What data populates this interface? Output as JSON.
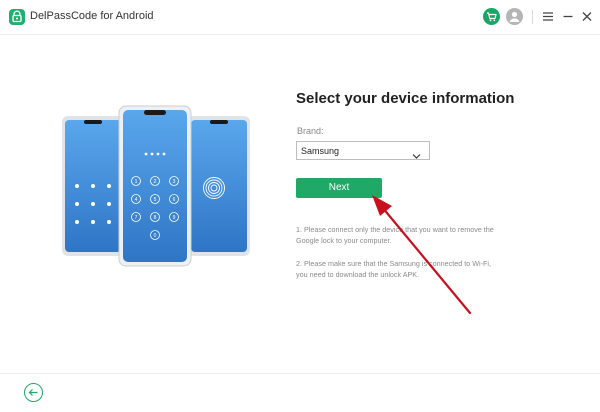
{
  "window": {
    "title": "DelPassCode for Android",
    "icons": [
      "app-logo-icon",
      "cart-icon",
      "user-icon",
      "menu-icon",
      "minimize-icon",
      "close-icon"
    ]
  },
  "colors": {
    "accent": "#1fa866",
    "phone_screen": "#3b87d8",
    "annotation_arrow": "#c8101e"
  },
  "main": {
    "heading": "Select your device information",
    "brand_label": "Brand:",
    "brand_value": "Samsung",
    "next_label": "Next",
    "notes": [
      "1. Please connect only the device that you want to remove the Google lock to your computer.",
      "2. Please make sure that the Samsung is connected to Wi-Fi, you need to download the unlock APK."
    ]
  },
  "footer": {
    "back_icon": "back-arrow-icon"
  }
}
